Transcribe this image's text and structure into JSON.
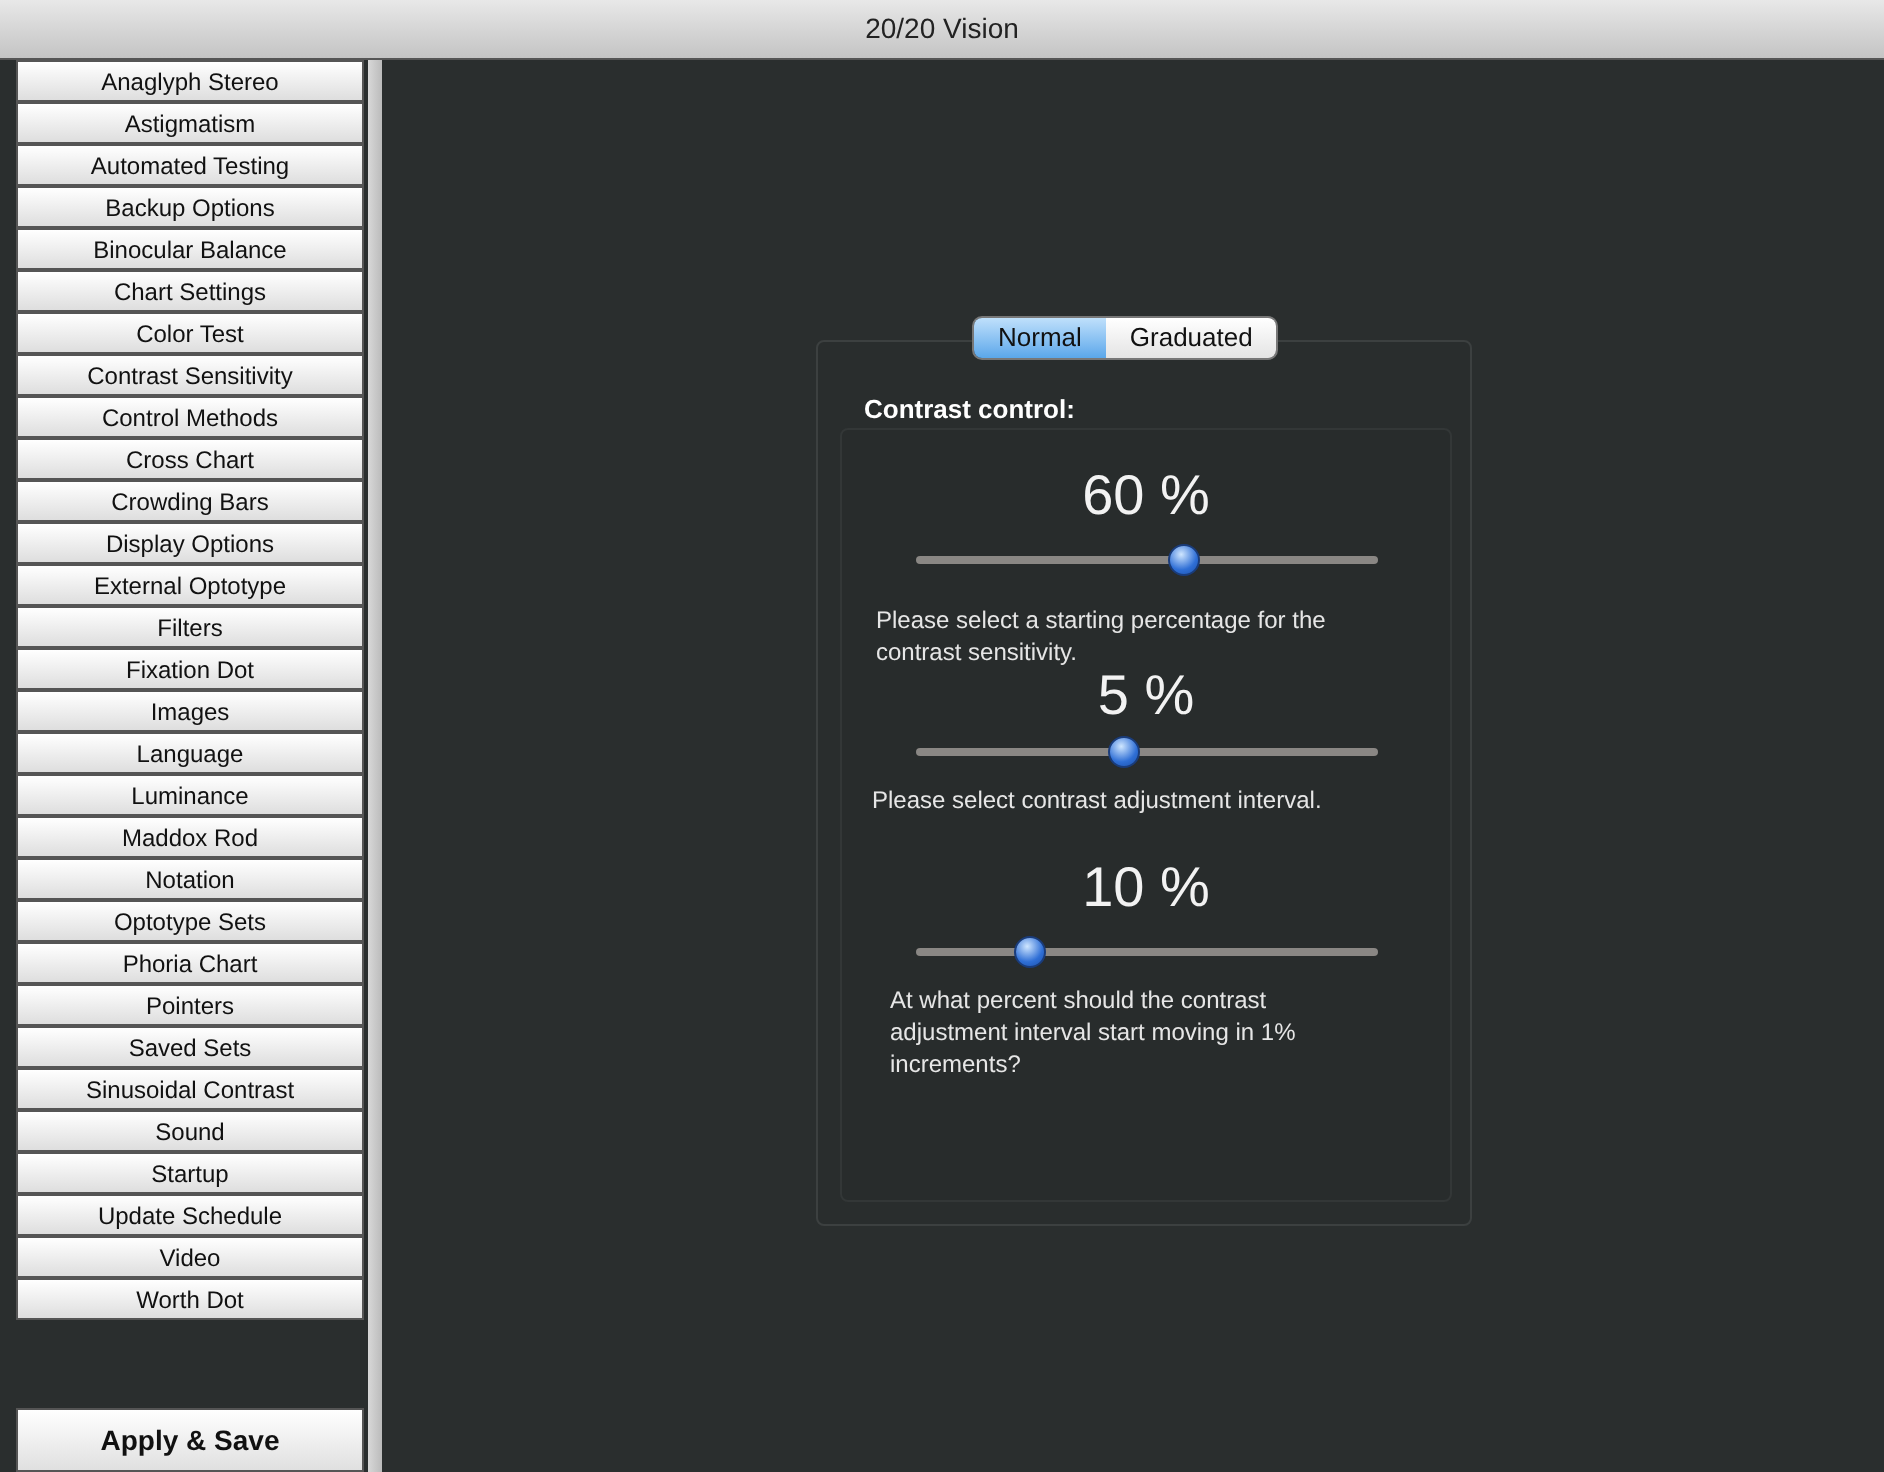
{
  "window": {
    "title": "20/20 Vision"
  },
  "sidebar": {
    "items": [
      {
        "label": "Anaglyph Stereo",
        "selected": false
      },
      {
        "label": "Astigmatism",
        "selected": false
      },
      {
        "label": "Automated Testing",
        "selected": false
      },
      {
        "label": "Backup Options",
        "selected": false
      },
      {
        "label": "Binocular Balance",
        "selected": false
      },
      {
        "label": "Chart Settings",
        "selected": false
      },
      {
        "label": "Color Test",
        "selected": false
      },
      {
        "label": "Contrast Sensitivity",
        "selected": false
      },
      {
        "label": "Control Methods",
        "selected": false
      },
      {
        "label": "Cross Chart",
        "selected": false
      },
      {
        "label": "Crowding Bars",
        "selected": false
      },
      {
        "label": "Display Options",
        "selected": false
      },
      {
        "label": "External Optotype",
        "selected": false
      },
      {
        "label": "Filters",
        "selected": false
      },
      {
        "label": "Fixation Dot",
        "selected": false
      },
      {
        "label": "Images",
        "selected": false
      },
      {
        "label": "Language",
        "selected": false
      },
      {
        "label": "Luminance",
        "selected": false
      },
      {
        "label": "Maddox Rod",
        "selected": false
      },
      {
        "label": "Notation",
        "selected": false
      },
      {
        "label": "Optotype Sets",
        "selected": false
      },
      {
        "label": "Phoria Chart",
        "selected": false
      },
      {
        "label": "Pointers",
        "selected": false
      },
      {
        "label": "Saved Sets",
        "selected": false
      },
      {
        "label": "Sinusoidal Contrast",
        "selected": false
      },
      {
        "label": "Sound",
        "selected": false
      },
      {
        "label": "Startup",
        "selected": false
      },
      {
        "label": "Update Schedule",
        "selected": false
      },
      {
        "label": "Video",
        "selected": false
      },
      {
        "label": "Worth Dot",
        "selected": false
      }
    ],
    "apply_button": "Apply & Save"
  },
  "panel": {
    "tabs": [
      {
        "label": "Normal",
        "selected": true
      },
      {
        "label": "Graduated",
        "selected": false
      }
    ],
    "heading": "Contrast control:",
    "sliders": [
      {
        "reading": "60 %",
        "level": 0.59,
        "description": "Please select a starting percentage for the contrast sensitivity."
      },
      {
        "reading": "5 %",
        "level": 0.45,
        "description": "Please select contrast adjustment interval."
      },
      {
        "reading": "10 %",
        "level": 0.23,
        "description": "At what percent should the contrast adjustment interval start moving in 1% increments?"
      }
    ]
  }
}
